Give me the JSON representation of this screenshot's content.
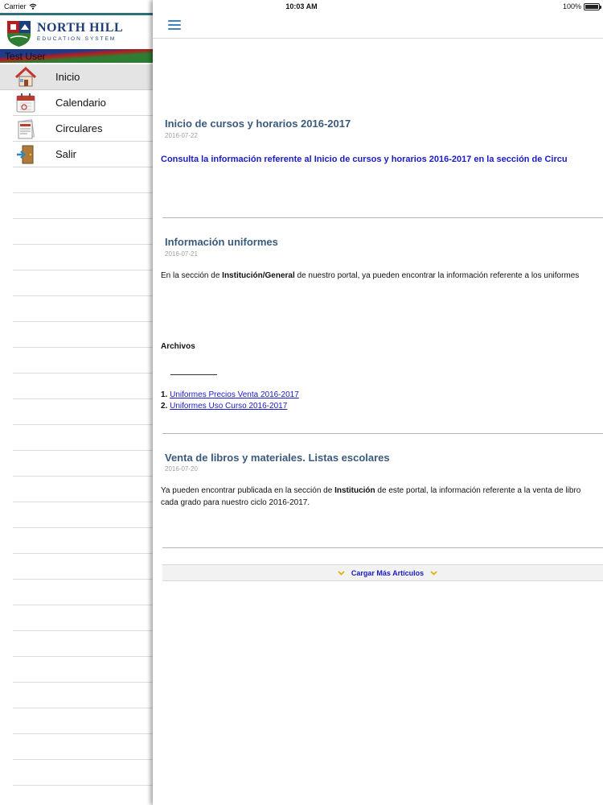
{
  "status_bar": {
    "carrier": "Carrier",
    "time": "10:03 AM",
    "battery": "100%",
    "battery_level": 1.0
  },
  "brand": {
    "name": "NORTH HILL",
    "subtitle": "EDUCATION SYSTEM",
    "colors": {
      "navy": "#1f3f7a",
      "red": "#b91c1c",
      "green": "#2e7d32",
      "teal": "#2a7178"
    }
  },
  "user": {
    "name": "Test User"
  },
  "menu": {
    "items": [
      {
        "label": "Inicio",
        "icon": "house-icon",
        "active": true
      },
      {
        "label": "Calendario",
        "icon": "calendar-icon",
        "active": false
      },
      {
        "label": "Circulares",
        "icon": "newspaper-icon",
        "active": false
      },
      {
        "label": "Salir",
        "icon": "exit-door-icon",
        "active": false
      }
    ]
  },
  "topbar": {
    "menu_icon": "hamburger-icon"
  },
  "articles": [
    {
      "title": "Inicio de cursos y horarios 2016-2017",
      "date": "2016-07-22",
      "headline": "Consulta la información referente al Inicio de cursos y horarios 2016-2017 en la sección de Circu"
    },
    {
      "title": "Información uniformes",
      "date": "2016-07-21",
      "text_prefix": "En la sección de ",
      "text_bold": "Institución/General",
      "text_suffix": " de nuestro portal, ya pueden encontrar la información referente a los uniformes",
      "files_heading": "Archivos",
      "files": [
        {
          "number": "1.",
          "label": "Uniformes Precios Venta 2016-2017"
        },
        {
          "number": "2.",
          "label": "Uniformes Uso Curso 2016-2017"
        }
      ]
    },
    {
      "title": "Venta de libros y materiales. Listas escolares",
      "date": "2016-07-20",
      "text_prefix": "Ya pueden encontrar publicada en la sección de ",
      "text_bold": "Institución",
      "text_suffix": " de este portal, la información referente a la venta de libro",
      "text_line2": "cada grado para nuestro ciclo 2016-2017."
    }
  ],
  "load_more": {
    "label": "Cargar Más Artículos",
    "icon": "chevron-down-icon"
  }
}
